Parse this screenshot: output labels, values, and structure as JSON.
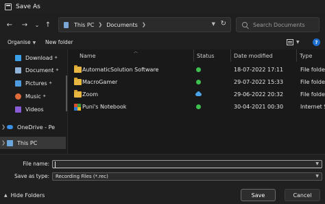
{
  "window": {
    "title": "Save As"
  },
  "nav": {
    "back": "←",
    "forward": "→",
    "recent": "⌄",
    "up": "↑",
    "breadcrumbs": [
      "This PC",
      "Documents"
    ],
    "refresh": "↻",
    "search_placeholder": "Search Documents"
  },
  "commands": {
    "organise": "Organise",
    "new_folder": "New folder"
  },
  "sidebar": {
    "items": [
      {
        "label": "Download",
        "icon": "download-icon",
        "pinned": true
      },
      {
        "label": "Document",
        "icon": "document-icon",
        "pinned": true
      },
      {
        "label": "Pictures",
        "icon": "pictures-icon",
        "pinned": true
      },
      {
        "label": "Music",
        "icon": "music-icon",
        "pinned": true
      },
      {
        "label": "Videos",
        "icon": "videos-icon",
        "pinned": false
      },
      {
        "label": "OneDrive - Pe",
        "icon": "onedrive-icon",
        "pinned": false
      },
      {
        "label": "This PC",
        "icon": "this-pc-icon",
        "pinned": false,
        "selected": true
      }
    ]
  },
  "columns": {
    "name": "Name",
    "status": "Status",
    "date_modified": "Date modified",
    "type": "Type"
  },
  "files": [
    {
      "name": "AutomaticSolution Software",
      "status": "check",
      "date": "18-07-2022 17:11",
      "type": "File folder",
      "icon": "folder-icon"
    },
    {
      "name": "MacroGamer",
      "status": "check",
      "date": "29-07-2022 15:33",
      "type": "File folder",
      "icon": "folder-icon"
    },
    {
      "name": "Zoom",
      "status": "cloud",
      "date": "29-06-2022 20:32",
      "type": "File folder",
      "icon": "folder-icon"
    },
    {
      "name": "Puni's Notebook",
      "status": "check",
      "date": "30-04-2021 00:30",
      "type": "Internet S",
      "icon": "web-shortcut-icon"
    }
  ],
  "form": {
    "file_name_label": "File name:",
    "file_name_value": "",
    "save_as_type_label": "Save as type:",
    "save_as_type_value": "Recording Files (*.rec)"
  },
  "footer": {
    "hide_folders": "Hide Folders",
    "save": "Save",
    "cancel": "Cancel"
  },
  "colors": {
    "accent": "#1e6fd0",
    "folder": "#e8b741",
    "status_ok": "#3fbf4f",
    "status_cloud": "#4aa3e6"
  }
}
